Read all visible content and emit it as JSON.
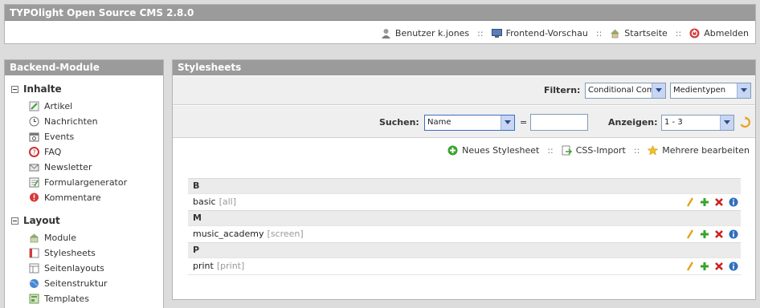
{
  "header": {
    "title": "TYPOlight Open Source CMS 2.8.0",
    "nav": {
      "user": "Benutzer k.jones",
      "preview": "Frontend-Vorschau",
      "home": "Startseite",
      "logout": "Abmelden",
      "separator": "::"
    }
  },
  "sidebar": {
    "title": "Backend-Module",
    "groups": [
      {
        "label": "Inhalte",
        "items": [
          "Artikel",
          "Nachrichten",
          "Events",
          "FAQ",
          "Newsletter",
          "Formulargenerator",
          "Kommentare"
        ]
      },
      {
        "label": "Layout",
        "items": [
          "Module",
          "Stylesheets",
          "Seitenlayouts",
          "Seitenstruktur",
          "Templates"
        ]
      }
    ]
  },
  "main": {
    "title": "Stylesheets",
    "filter": {
      "label": "Filtern:",
      "conditional": "Conditional Com",
      "media": "Medientypen"
    },
    "search": {
      "label": "Suchen:",
      "field": "Name",
      "equals": "=",
      "value": ""
    },
    "display": {
      "label": "Anzeigen:",
      "range": "1 - 3"
    },
    "actions": {
      "new": "Neues Stylesheet",
      "import": "CSS-Import",
      "edit_multiple": "Mehrere bearbeiten",
      "separator": "::"
    },
    "list": [
      {
        "group": "B",
        "name": "basic",
        "media": "[all]"
      },
      {
        "group": "M",
        "name": "music_academy",
        "media": "[screen]"
      },
      {
        "group": "P",
        "name": "print",
        "media": "[print]"
      }
    ]
  },
  "colors": {
    "panel_header": "#9b9b9b",
    "accent_green": "#3aa32f",
    "delete_red": "#cc2222",
    "info_blue": "#2f6fc0"
  }
}
